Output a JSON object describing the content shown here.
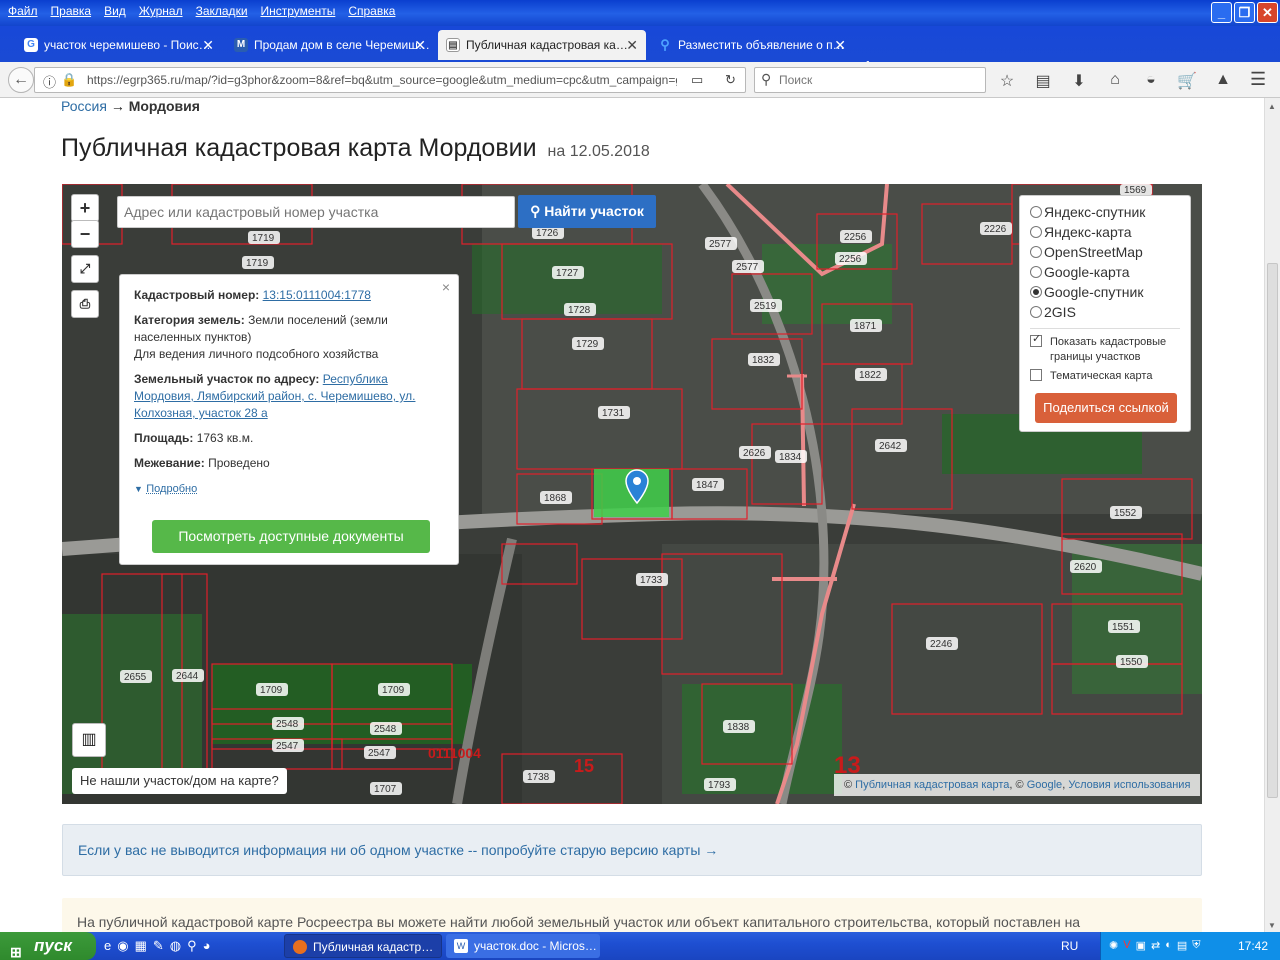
{
  "window": {
    "menu": [
      "Файл",
      "Правка",
      "Вид",
      "Журнал",
      "Закладки",
      "Инструменты",
      "Справка"
    ],
    "controls": {
      "minimize": "_",
      "maximize": "❐",
      "close": "✕"
    }
  },
  "tabs": [
    {
      "label": "участок черемишево - Поис…",
      "icon": "google-icon"
    },
    {
      "label": "Продам дом в селе Черемиш…",
      "icon": "m-icon"
    },
    {
      "label": "Публичная кадастровая ка…",
      "icon": "page-icon",
      "active": true
    },
    {
      "label": "Разместить объявление о п…",
      "icon": "pin-icon"
    }
  ],
  "nav": {
    "url": "https://egrp365.ru/map/?id=g3phor&zoom=8&ref=bq&utm_source=google&utm_medium=cpc&utm_campaign=gmap&ut",
    "search_placeholder": "Поиск"
  },
  "page": {
    "breadcrumb": {
      "root": "Россия",
      "sep": "→",
      "current": "Мордовия"
    },
    "title": "Публичная кадастровая карта Мордовии",
    "date": "на 12.05.2018",
    "map": {
      "zoom_in": "+",
      "zoom_out": "−",
      "address_placeholder": "Адрес или кадастровый номер участка",
      "find_button": "Найти участок",
      "popup": {
        "close": "×",
        "cadastral_label": "Кадастровый номер:",
        "cadastral_value": "13:15:0111004:1778",
        "category_label": "Категория земель:",
        "category_value": "Земли поселений (земли населенных пунктов)",
        "purpose": "Для ведения личного подсобного хозяйства",
        "address_label": "Земельный участок по адресу:",
        "address_value": "Республика Мордовия, Лямбирский район, с. Черемишево, ул. Колхозная, участок 28 а",
        "area_label": "Площадь:",
        "area_value": "1763 кв.м.",
        "survey_label": "Межевание:",
        "survey_value": "Проведено",
        "more": "Подробно",
        "docs_button": "Посмотреть доступные документы"
      },
      "layers": {
        "options": [
          "Яндекс-спутник",
          "Яндекс-карта",
          "OpenStreetMap",
          "Google-карта",
          "Google-спутник",
          "2GIS"
        ],
        "selected": "Google-спутник",
        "show_borders": "Показать кадастровые границы участков",
        "show_borders_checked": true,
        "thematic": "Тематическая карта",
        "thematic_checked": false,
        "share_button": "Поделиться ссылкой"
      },
      "not_found": "Не нашли участок/дом на карте?",
      "attribution": {
        "prefix": "©",
        "source": "Публичная кадастровая карта",
        "mid": ", ©",
        "google": "Google",
        "terms": "Условия использования"
      },
      "parcel_labels": [
        "1719",
        "1719",
        "1726",
        "1727",
        "1728",
        "1729",
        "1731",
        "1868",
        "1847",
        "1834",
        "1832",
        "1871",
        "1822",
        "2519",
        "2577",
        "2577",
        "2256",
        "2256",
        "2226",
        "1569",
        "2642",
        "2626",
        "1552",
        "2620",
        "1551",
        "1550",
        "2246",
        "1733",
        "1838",
        "1793",
        "1738",
        "1707",
        "1709",
        "1709",
        "2548",
        "2548",
        "2547",
        "2547",
        "2655",
        "2644"
      ],
      "quarter_labels": [
        "0111004",
        "15",
        "13"
      ],
      "colors": {
        "parcel_border": "#e0202a",
        "selected_fill": "#3fcf4a",
        "marker": "#2a82d6"
      }
    },
    "info_old_version": "Если у вас не выводится информация ни об одном участке -- попробуйте старую версию карты →",
    "info_text": "На публичной кадастровой карте Росреестра вы можете найти любой земельный участок или объект капитального строительства, который поставлен на"
  },
  "taskbar": {
    "start": "пуск",
    "tasks": [
      {
        "label": "Публичная кадастр…",
        "active": true
      },
      {
        "label": "участок.doc - Micros…",
        "active": false
      }
    ],
    "lang": "RU",
    "clock": "17:42"
  }
}
